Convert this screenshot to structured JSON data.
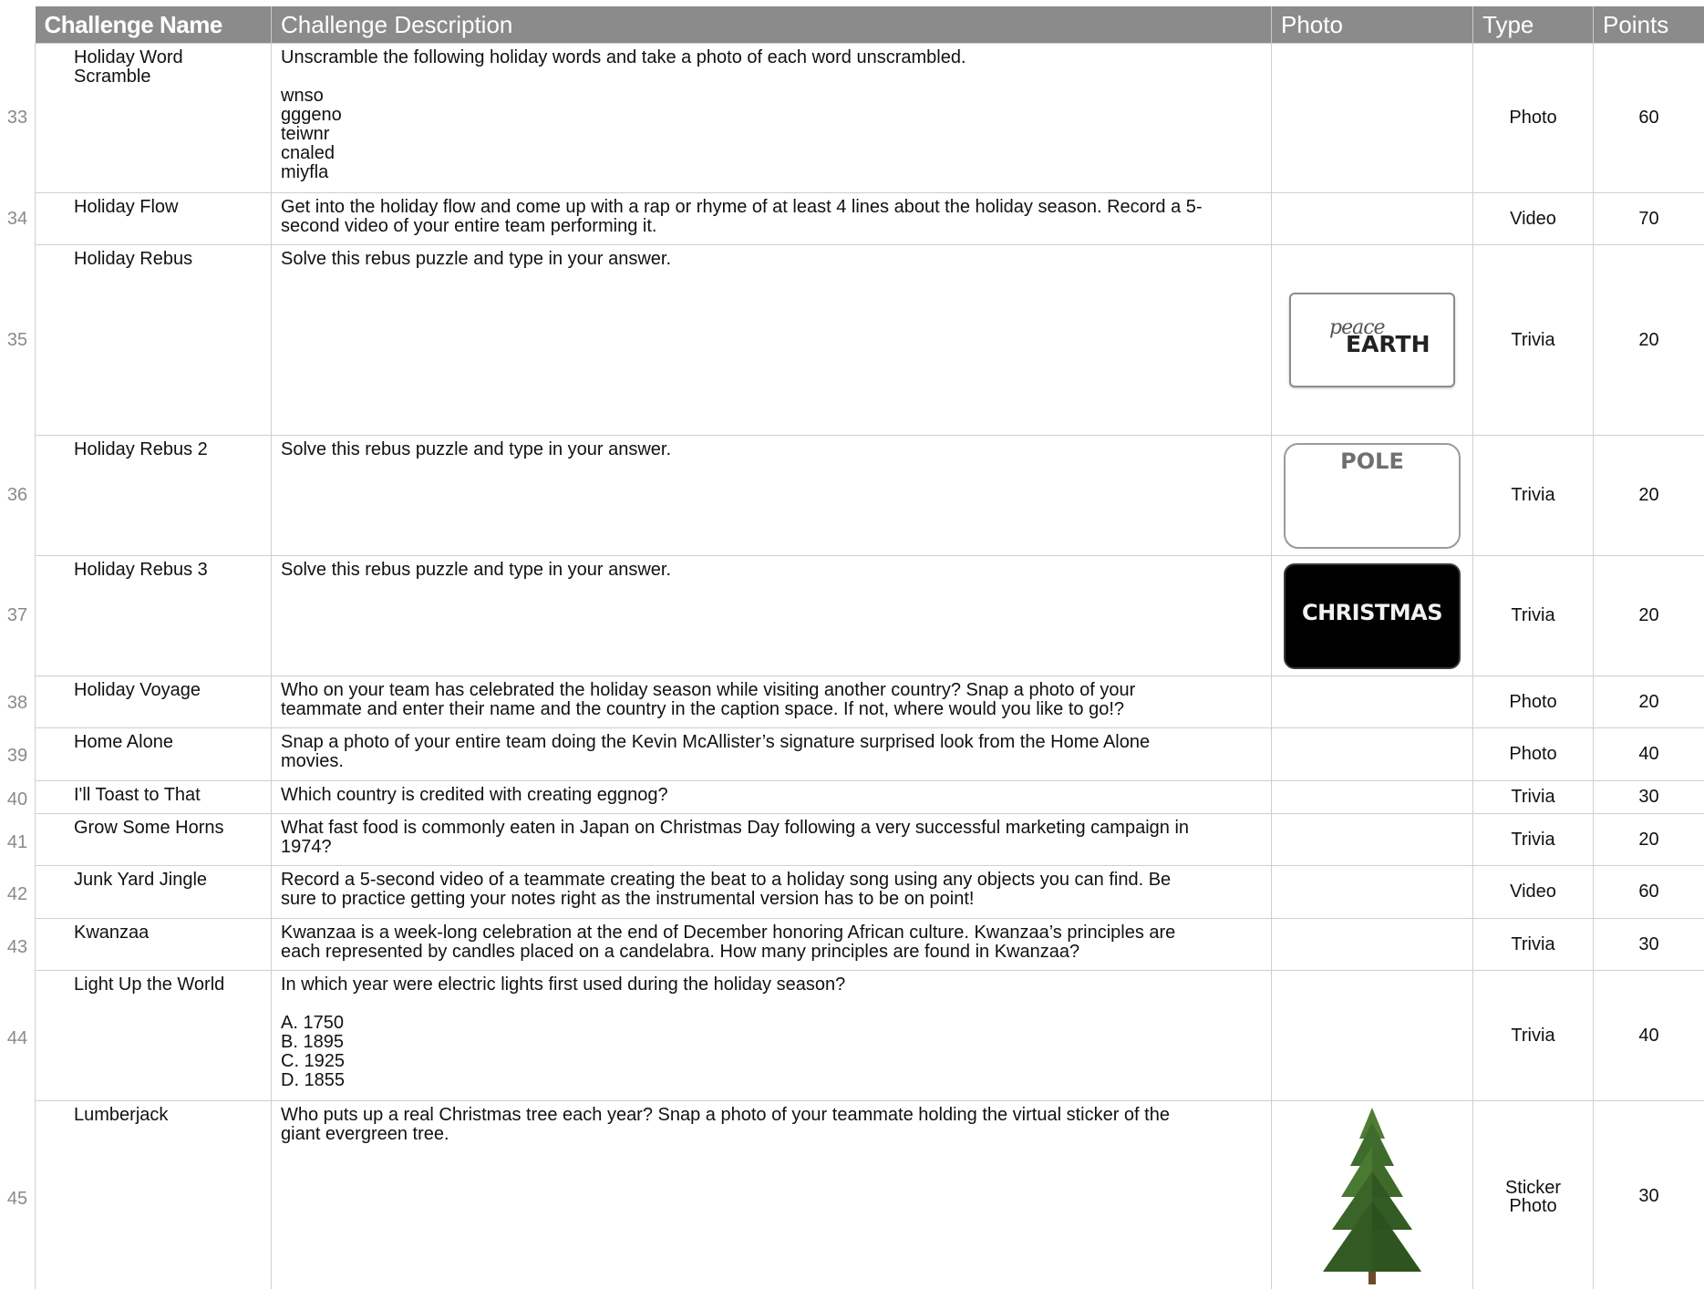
{
  "header": {
    "name": "Challenge Name",
    "description": "Challenge Description",
    "photo": "Photo",
    "type": "Type",
    "points": "Points"
  },
  "rows": [
    {
      "num": "33",
      "name": "Holiday Word Scramble",
      "description": "Unscramble the following holiday words and take a photo of each word unscrambled.",
      "lines": [
        "wnso",
        "gggeno",
        "teiwnr",
        "cnaled",
        "miyfla"
      ],
      "photo": "",
      "type": "Photo",
      "points": "60"
    },
    {
      "num": "34",
      "name": "Holiday Flow",
      "description": "Get into the holiday flow and come up with a rap or rhyme of at least 4 lines about the holiday season. Record a 5-\nsecond video of your entire team performing it.",
      "photo": "",
      "type": "Video",
      "points": "70"
    },
    {
      "num": "35",
      "name": "Holiday Rebus",
      "description": "Solve this rebus puzzle and type in your answer.",
      "photo": {
        "icon": "rebus-peace-earth-image",
        "small": "peace",
        "big": "EARTH"
      },
      "type": "Trivia",
      "points": "20"
    },
    {
      "num": "36",
      "name": "Holiday Rebus 2",
      "description": "Solve this rebus puzzle and type in your answer.",
      "photo": {
        "icon": "rebus-pole-image",
        "big": "POLE"
      },
      "type": "Trivia",
      "points": "20"
    },
    {
      "num": "37",
      "name": "Holiday Rebus 3",
      "description": "Solve this rebus puzzle and type in your answer.",
      "photo": {
        "icon": "rebus-christmas-image",
        "big": "CHRISTMAS"
      },
      "type": "Trivia",
      "points": "20"
    },
    {
      "num": "38",
      "name": "Holiday Voyage",
      "description": "Who on your team has celebrated the holiday season while visiting another country? Snap a photo of your\nteammate and enter their name and the country in the caption space. If not, where would you like to go!?",
      "photo": "",
      "type": "Photo",
      "points": "20"
    },
    {
      "num": "39",
      "name": "Home Alone",
      "description": "Snap a photo of your entire team doing the Kevin McAllister’s signature surprised look from the Home Alone\nmovies.",
      "photo": "",
      "type": "Photo",
      "points": "40"
    },
    {
      "num": "40",
      "name": "I'll Toast to That",
      "description": "Which country is credited with creating eggnog?",
      "photo": "",
      "type": "Trivia",
      "points": "30"
    },
    {
      "num": "41",
      "name": "Grow Some Horns",
      "description": "What fast food is commonly eaten in Japan on Christmas Day following a very successful marketing campaign in\n1974?",
      "photo": "",
      "type": "Trivia",
      "points": "20"
    },
    {
      "num": "42",
      "name": "Junk Yard Jingle",
      "description": "Record a 5-second video of a teammate creating the beat to a holiday song using any objects you can find. Be\nsure to practice getting your notes right as the instrumental version has to be on point!",
      "photo": "",
      "type": "Video",
      "points": "60"
    },
    {
      "num": "43",
      "name": "Kwanzaa",
      "description": "Kwanzaa is a week-long celebration at the end of December honoring African culture. Kwanzaa’s principles are\neach represented by candles placed on a candelabra. How many principles are found in Kwanzaa?",
      "photo": "",
      "type": "Trivia",
      "points": "30"
    },
    {
      "num": "44",
      "name": "Light Up the World",
      "description": "In which year were electric lights first used during the holiday season?",
      "lines": [
        "A. 1750",
        "B. 1895",
        "C. 1925",
        "D. 1855"
      ],
      "photo": "",
      "type": "Trivia",
      "points": "40"
    },
    {
      "num": "45",
      "name": "Lumberjack",
      "description": "Who puts up a real Christmas tree each year? Snap a photo of your teammate holding the virtual sticker of the\ngiant evergreen tree.",
      "photo": {
        "icon": "evergreen-tree-image"
      },
      "type": "Sticker\nPhoto",
      "points": "30"
    }
  ],
  "colors": {
    "header_bg": "#8b8b8b",
    "header_text": "#ffffff",
    "grid": "#cfcfcf",
    "rownum": "#8a8a8a",
    "tree_green": "#3f6b2c"
  }
}
